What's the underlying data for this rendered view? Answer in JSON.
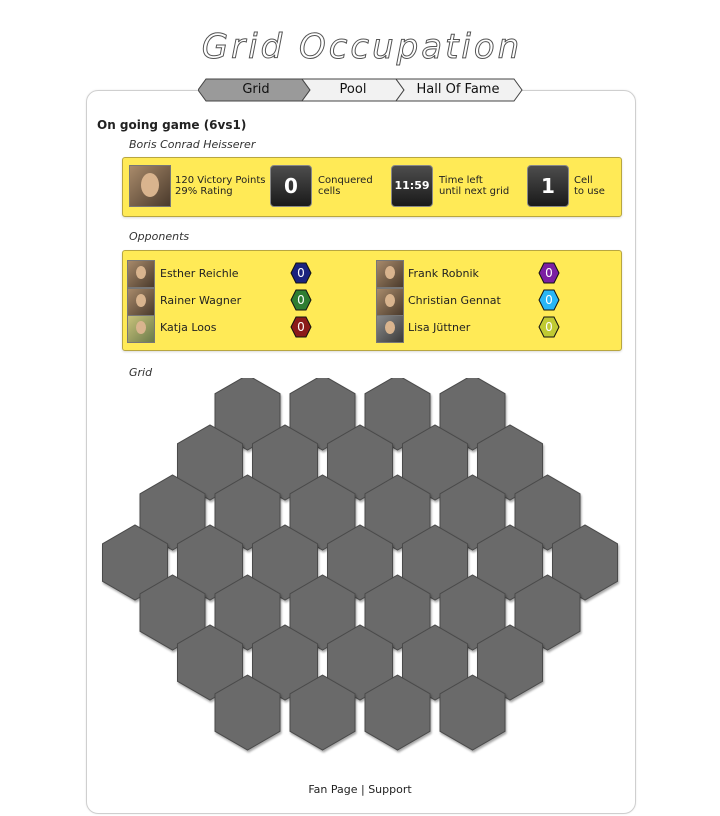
{
  "app": {
    "logo_text": "Grid Occupation"
  },
  "tabs": [
    {
      "label": "Grid",
      "active": true
    },
    {
      "label": "Pool",
      "active": false
    },
    {
      "label": "Hall Of Fame",
      "active": false
    }
  ],
  "game": {
    "title": "On going game (6vs1)",
    "player_name": "Boris Conrad Heisserer",
    "victory_points": "120 Victory Points",
    "rating": "29% Rating",
    "conquered_value": "0",
    "conquered_label_1": "Conquered",
    "conquered_label_2": "cells",
    "time_value": "11:59",
    "time_label_1": "Time left",
    "time_label_2": "until next grid",
    "cell_value": "1",
    "cell_label_1": "Cell",
    "cell_label_2": "to use"
  },
  "opponents_label": "Opponents",
  "opponents": [
    {
      "name": "Esther Reichle",
      "score": "0",
      "color": "#1a237e"
    },
    {
      "name": "Frank Robnik",
      "score": "0",
      "color": "#7b1fa2"
    },
    {
      "name": "Rainer Wagner",
      "score": "0",
      "color": "#2e7d32"
    },
    {
      "name": "Christian Gennat",
      "score": "0",
      "color": "#29b6f6"
    },
    {
      "name": "Katja Loos",
      "score": "0",
      "color": "#8b1a1a"
    },
    {
      "name": "Lisa Jüttner",
      "score": "0",
      "color": "#c0ca33"
    }
  ],
  "grid_label": "Grid",
  "grid": {
    "cell_color": "#6a6a6a",
    "rows": [
      4,
      5,
      6,
      7,
      6,
      5,
      4
    ]
  },
  "footer": {
    "fan_page": "Fan Page",
    "separator": " | ",
    "support": "Support"
  }
}
